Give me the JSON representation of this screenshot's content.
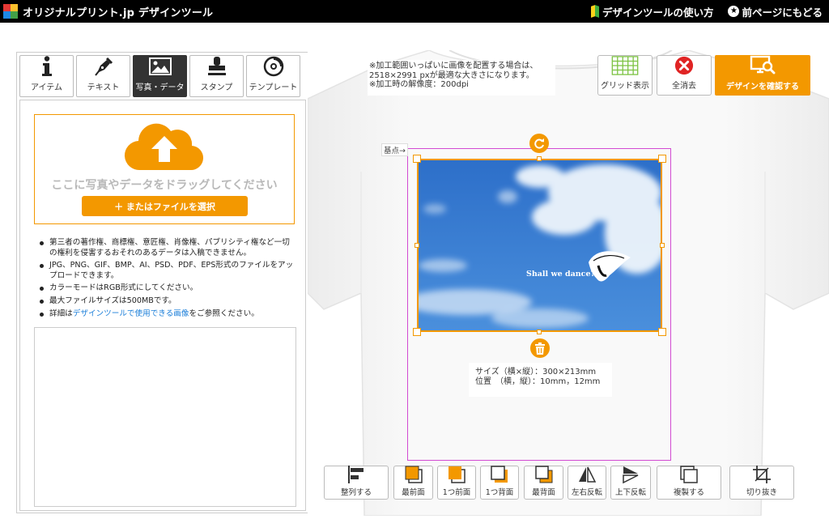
{
  "header": {
    "logo_text": "オリジナルプリント.jp デザインツール",
    "guide_link": "デザインツールの使い方",
    "back_link": "前ページにもどる"
  },
  "tabs": [
    {
      "label": "アイテム",
      "icon": "info-icon",
      "active": false
    },
    {
      "label": "テキスト",
      "icon": "pen-icon",
      "active": false
    },
    {
      "label": "写真・データ",
      "icon": "image-icon",
      "active": true
    },
    {
      "label": "スタンプ",
      "icon": "stamp-icon",
      "active": false
    },
    {
      "label": "テンプレート",
      "icon": "template-icon",
      "active": false
    }
  ],
  "upload": {
    "drop_text": "ここに写真やデータをドラッグしてください",
    "file_button": "＋ またはファイルを選択",
    "notes": [
      "第三者の著作権、商標権、意匠権、肖像権、パブリシティ権など一切の権利を侵害するおそれのあるデータは入稿できません。",
      "JPG、PNG、GIF、BMP、AI、PSD、PDF、EPS形式のファイルをアップロードできます。",
      "カラーモードはRGB形式にしてください。",
      "最大ファイルサイズは500MBです。"
    ],
    "note_detail_prefix": "詳細は",
    "note_detail_link": "デザインツールで使用できる画像",
    "note_detail_suffix": "をご参照ください。"
  },
  "canvas": {
    "info_lines": [
      "※加工範囲いっぱいに画像を配置する場合は、",
      "2518×2991 pxが最適な大きさになります。",
      "※加工時の解像度：200dpi"
    ],
    "base_point_label": "基点→",
    "photo_caption": "Shall we dance?",
    "size_line": "サイズ（横×縦）：300×213mm",
    "position_line": "位置　（横，縦）：10mm，12mm"
  },
  "toolbar": {
    "grid_label": "グリッド表示",
    "clear_label": "全消去",
    "confirm_label": "デザインを確認する"
  },
  "bottom_tools": [
    {
      "label": "整列する",
      "icon": "align-icon"
    },
    {
      "label": "最前面",
      "icon": "bring-front-icon"
    },
    {
      "label": "1つ前面",
      "icon": "bring-forward-icon"
    },
    {
      "label": "1つ背面",
      "icon": "send-backward-icon"
    },
    {
      "label": "最背面",
      "icon": "send-back-icon"
    },
    {
      "label": "左右反転",
      "icon": "flip-horizontal-icon"
    },
    {
      "label": "上下反転",
      "icon": "flip-vertical-icon"
    },
    {
      "label": "複製する",
      "icon": "duplicate-icon"
    },
    {
      "label": "切り抜き",
      "icon": "crop-icon"
    }
  ],
  "colors": {
    "accent": "#f39800",
    "print_area_border": "#d24bd2",
    "link": "#1a7ed9",
    "clear_red": "#e02424"
  }
}
